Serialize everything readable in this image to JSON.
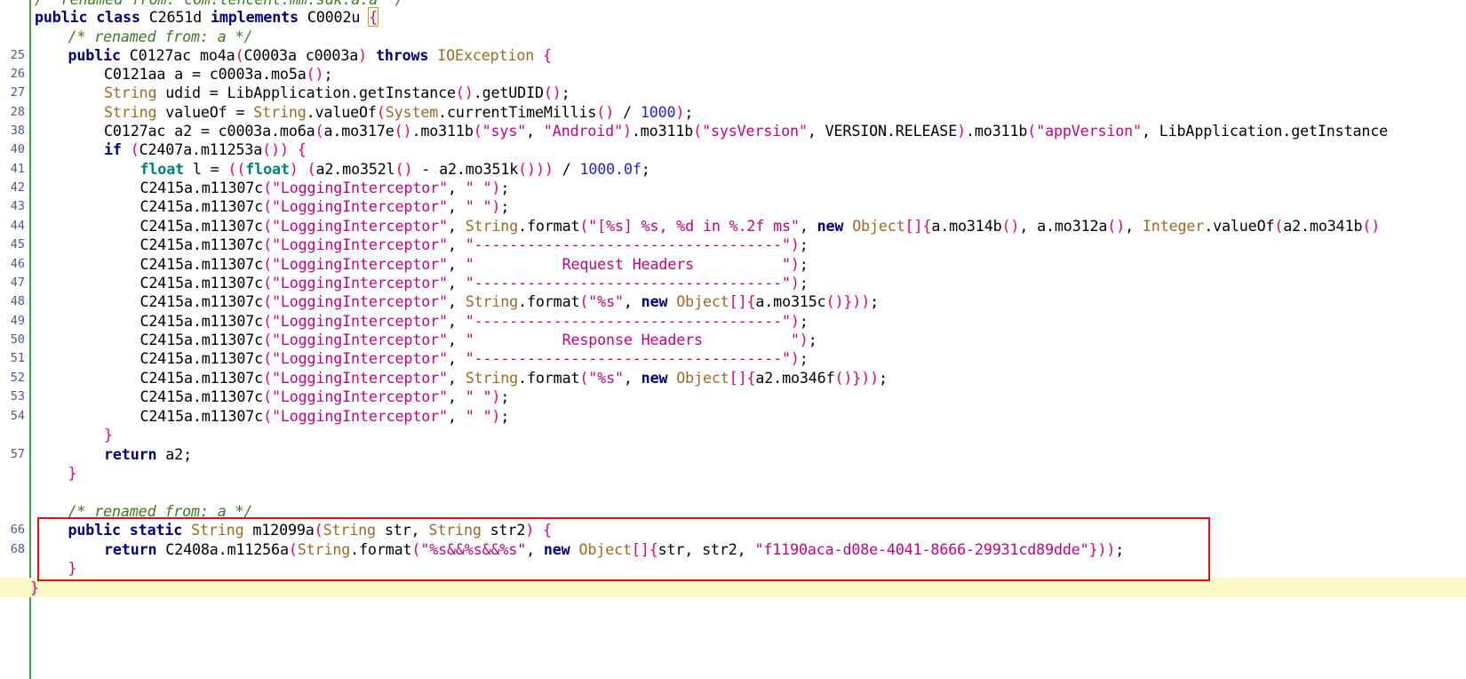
{
  "editor": {
    "top_comment": "/* renamed from: com.tencent.mm.sdk.a.a */",
    "class_decl": {
      "kw_public": "public",
      "kw_class": "class",
      "name": "C2651d",
      "kw_implements": "implements",
      "iface": "C0002u",
      "brace": "{"
    },
    "lines": [
      {
        "ln": "",
        "code": "/* renamed from: a */"
      },
      {
        "ln": "25",
        "code": "public C0127ac mo4a(C0003a c0003a) throws IOException {"
      },
      {
        "ln": "26",
        "code": "C0121aa a = c0003a.mo5a();"
      },
      {
        "ln": "27",
        "code": "String udid = LibApplication.getInstance().getUDID();"
      },
      {
        "ln": "28",
        "code": "String valueOf = String.valueOf(System.currentTimeMillis() / 1000);"
      },
      {
        "ln": "38",
        "code": "C0127ac a2 = c0003a.mo6a(a.mo317e().mo311b(\"sys\", \"Android\").mo311b(\"sysVersion\", VERSION.RELEASE).mo311b(\"appVersion\", LibApplication.getInstance"
      },
      {
        "ln": "40",
        "code": "if (C2407a.m11253a()) {"
      },
      {
        "ln": "41",
        "code": "float l = ((float) (a2.mo352l() - a2.mo351k())) / 1000.0f;"
      },
      {
        "ln": "42",
        "code": "C2415a.m11307c(\"LoggingInterceptor\", \" \");"
      },
      {
        "ln": "43",
        "code": "C2415a.m11307c(\"LoggingInterceptor\", \" \");"
      },
      {
        "ln": "44",
        "code": "C2415a.m11307c(\"LoggingInterceptor\", String.format(\"[%s] %s, %d in %.2f ms\", new Object[]{a.mo314b(), a.mo312a(), Integer.valueOf(a2.mo341b()"
      },
      {
        "ln": "45",
        "code": "C2415a.m11307c(\"LoggingInterceptor\", \"-----------------------------------\");"
      },
      {
        "ln": "46",
        "code": "C2415a.m11307c(\"LoggingInterceptor\", \"          Request Headers          \");"
      },
      {
        "ln": "47",
        "code": "C2415a.m11307c(\"LoggingInterceptor\", \"-----------------------------------\");"
      },
      {
        "ln": "48",
        "code": "C2415a.m11307c(\"LoggingInterceptor\", String.format(\"%s\", new Object[]{a.mo315c()}));"
      },
      {
        "ln": "49",
        "code": "C2415a.m11307c(\"LoggingInterceptor\", \"-----------------------------------\");"
      },
      {
        "ln": "50",
        "code": "C2415a.m11307c(\"LoggingInterceptor\", \"          Response Headers          \");"
      },
      {
        "ln": "51",
        "code": "C2415a.m11307c(\"LoggingInterceptor\", \"-----------------------------------\");"
      },
      {
        "ln": "52",
        "code": "C2415a.m11307c(\"LoggingInterceptor\", String.format(\"%s\", new Object[]{a2.mo346f()}));"
      },
      {
        "ln": "53",
        "code": "C2415a.m11307c(\"LoggingInterceptor\", \" \");"
      },
      {
        "ln": "54",
        "code": "C2415a.m11307c(\"LoggingInterceptor\", \" \");"
      },
      {
        "ln": "",
        "code": "}"
      },
      {
        "ln": "57",
        "code": "return a2;"
      },
      {
        "ln": "",
        "code": "}"
      },
      {
        "ln": "",
        "code": ""
      },
      {
        "ln": "",
        "code": "/* renamed from: a */"
      },
      {
        "ln": "66",
        "code": "public static String m12099a(String str, String str2) {"
      },
      {
        "ln": "68",
        "code": "return C2408a.m11256a(String.format(\"%s&&%s&&%s\", new Object[]{str, str2, \"f1190aca-d08e-4041-8666-29931cd89dde\"}));"
      },
      {
        "ln": "",
        "code": "}"
      },
      {
        "ln": "",
        "code": "}"
      }
    ],
    "highlighted_line_index": 29,
    "selection_box_note": "lines 66-68 enclosed in red box"
  }
}
